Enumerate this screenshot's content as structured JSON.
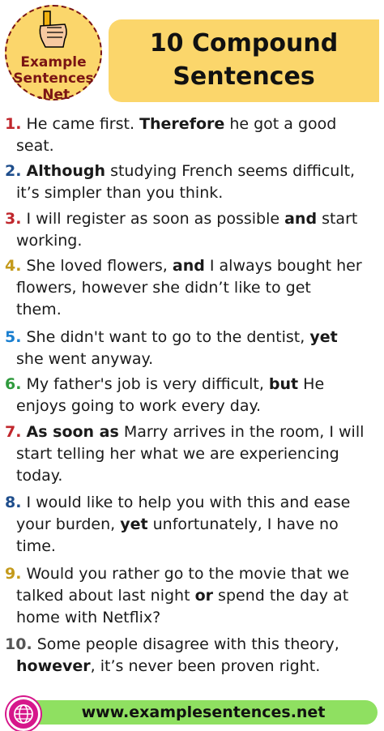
{
  "brand": {
    "line1": "Example",
    "line2": "Sentences",
    "line3": ".Net"
  },
  "title": {
    "line1": "10 Compound",
    "line2": "Sentences"
  },
  "colors": {
    "yellow": "#fbd66b",
    "maroon": "#7a1414",
    "green": "#8fe061",
    "magenta": "#d6178b"
  },
  "items": [
    {
      "num": "1.",
      "color": "#c0272d",
      "lines": [
        [
          "He came first. ",
          "B:Therefore",
          " he got a good"
        ],
        [
          "seat."
        ]
      ]
    },
    {
      "num": "2.",
      "color": "#1f4e8c",
      "lines": [
        [
          "B:Although",
          " studying French seems difficult,"
        ],
        [
          "it’s simpler than you think."
        ]
      ]
    },
    {
      "num": "3.",
      "color": "#c0272d",
      "lines": [
        [
          "I will register as soon as possible ",
          "B:and",
          " start"
        ],
        [
          "working."
        ]
      ]
    },
    {
      "num": "4.",
      "color": "#c49a1b",
      "lines": [
        [
          "She loved flowers, ",
          "B:and",
          " I always bought her"
        ],
        [
          "flowers, however she didn’t like to get"
        ],
        [
          "them."
        ]
      ]
    },
    {
      "num": "5.",
      "color": "#1a7fd0",
      "lines": [
        [
          "She didn't want to go to the dentist, ",
          "B:yet"
        ],
        [
          "she went anyway."
        ]
      ]
    },
    {
      "num": "6.",
      "color": "#2f9a3d",
      "lines": [
        [
          "My father's job is very difficult, ",
          "B:but",
          " He"
        ],
        [
          "enjoys going to work every day."
        ]
      ]
    },
    {
      "num": "7.",
      "color": "#c0272d",
      "lines": [
        [
          "B:As soon as",
          " Marry arrives in the room, I will"
        ],
        [
          "start telling her what we are experiencing"
        ],
        [
          "today."
        ]
      ]
    },
    {
      "num": "8.",
      "color": "#1f4e8c",
      "lines": [
        [
          "I would like to help you with this and ease"
        ],
        [
          "your burden, ",
          "B:yet",
          " unfortunately, I have no"
        ],
        [
          "time."
        ]
      ]
    },
    {
      "num": "9.",
      "color": "#c49a1b",
      "lines": [
        [
          "Would you rather go to the movie that we"
        ],
        [
          "talked about last night ",
          "B:or",
          " spend the day at"
        ],
        [
          "home with Netflix?"
        ]
      ]
    },
    {
      "num": "10.",
      "color": "#555555",
      "lines": [
        [
          "Some people disagree with this theory,"
        ],
        [
          "B:however",
          ", it’s never been proven right."
        ]
      ]
    }
  ],
  "footer": {
    "url": "www.examplesentences.net",
    "icon": "globe-icon"
  }
}
